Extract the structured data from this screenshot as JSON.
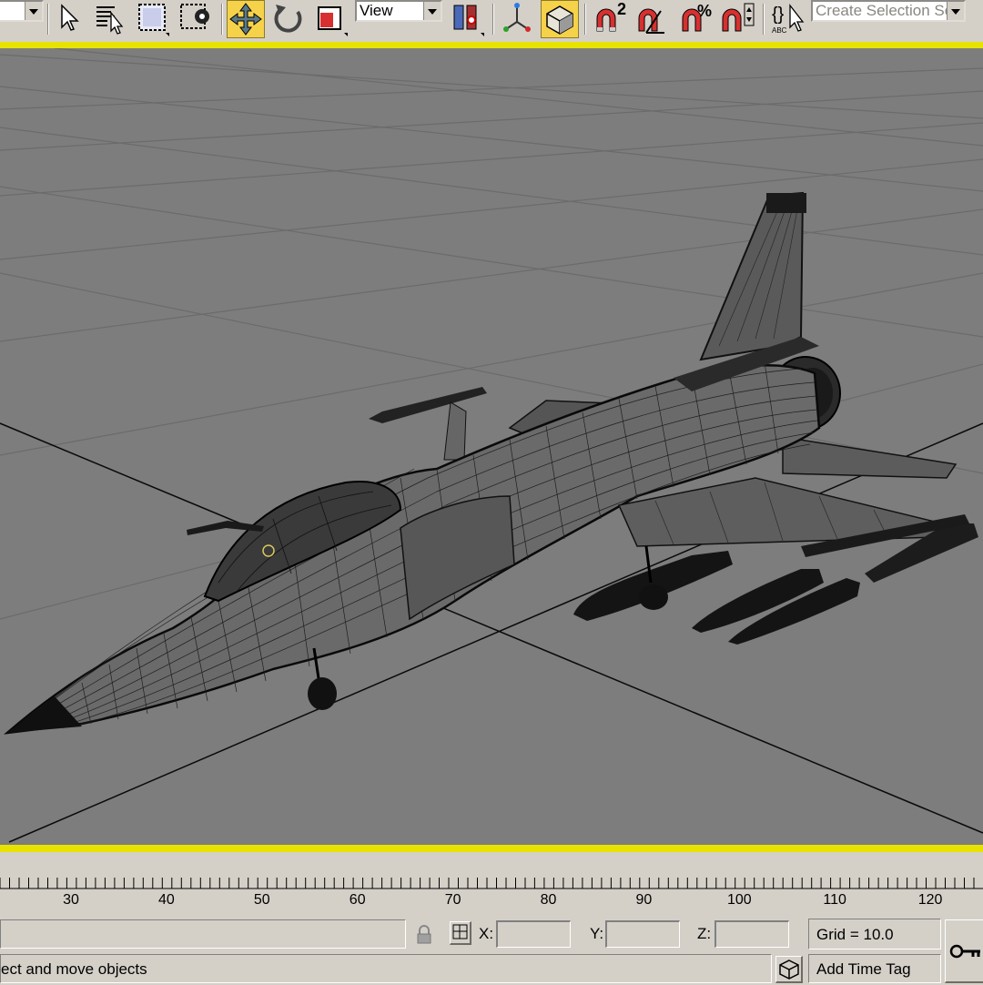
{
  "toolbar": {
    "view_combo": "View",
    "selection_set_placeholder": "Create Selection Set",
    "buttons": [
      "select-object",
      "select-by-name",
      "rectangular-selection-region",
      "window-crossing-selection",
      "select-and-move",
      "select-and-rotate",
      "select-and-uniform-scale",
      "use-pivot-point-center",
      "select-and-manipulate",
      "keyboard-shortcut-override",
      "snaps-toggle",
      "angle-snap-toggle",
      "percent-snap-toggle",
      "spinner-snap-toggle",
      "edit-named-selection-sets"
    ],
    "active_button": "select-and-move",
    "snap_label": "2"
  },
  "viewport": {
    "border_color": "#e7e200",
    "background_color": "#7d7d7d",
    "grid_color": "#6e6e6e",
    "wire_color": "#111111"
  },
  "timeline": {
    "ticks": [
      "30",
      "40",
      "50",
      "60",
      "70",
      "80",
      "90",
      "100",
      "110",
      "120"
    ]
  },
  "status": {
    "prompt": "ect and move objects",
    "x_label": "X:",
    "y_label": "Y:",
    "z_label": "Z:",
    "x_value": "",
    "y_value": "",
    "z_value": "",
    "grid": "Grid = 10.0",
    "add_time_tag": "Add Time Tag"
  }
}
